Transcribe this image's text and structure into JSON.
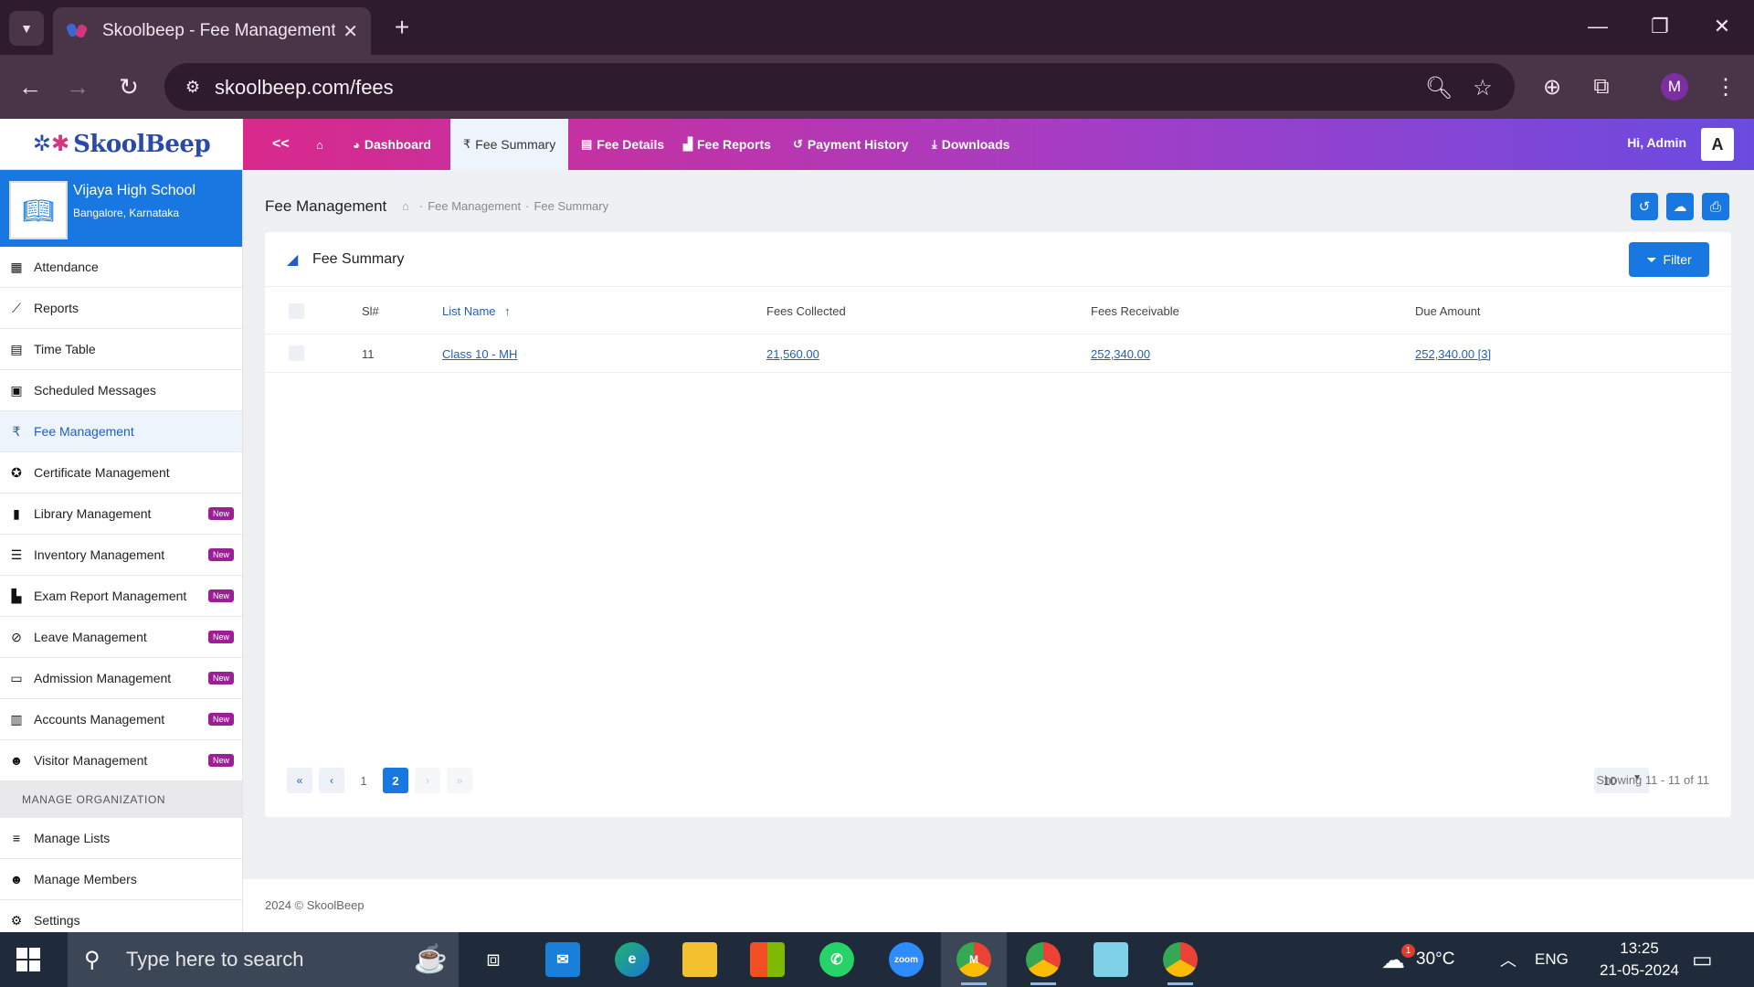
{
  "browser": {
    "tab_title": "Skoolbeep - Fee Management",
    "close_glyph": "✕",
    "new_tab_glyph": "+",
    "url": "skoolbeep.com/fees",
    "profile_initial": "M"
  },
  "app": {
    "logo_text": "SkoolBeep",
    "nav": [
      {
        "label": "<<"
      },
      {
        "label": "Dashboard"
      },
      {
        "label": "Fee Summary"
      },
      {
        "label": "Fee Details"
      },
      {
        "label": "Fee Reports"
      },
      {
        "label": "Payment History"
      },
      {
        "label": "Downloads"
      }
    ],
    "greeting": "Hi, Admin",
    "avatar_initial": "A"
  },
  "sidebar": {
    "school_name": "Vijaya High School",
    "school_location": "Bangalore, Karnataka",
    "new_badge": "New",
    "items": [
      {
        "label": "Attendance",
        "icon": "calendar-icon"
      },
      {
        "label": "Reports",
        "icon": "chart-line-icon"
      },
      {
        "label": "Time Table",
        "icon": "timetable-icon"
      },
      {
        "label": "Scheduled Messages",
        "icon": "calendar-check-icon"
      },
      {
        "label": "Fee Management",
        "icon": "rupee-icon"
      },
      {
        "label": "Certificate Management",
        "icon": "award-icon"
      },
      {
        "label": "Library Management",
        "icon": "book-icon"
      },
      {
        "label": "Inventory Management",
        "icon": "list-icon"
      },
      {
        "label": "Exam Report Management",
        "icon": "file-icon"
      },
      {
        "label": "Leave Management",
        "icon": "user-slash-icon"
      },
      {
        "label": "Admission Management",
        "icon": "id-card-icon"
      },
      {
        "label": "Accounts Management",
        "icon": "file-invoice-icon"
      },
      {
        "label": "Visitor Management",
        "icon": "users-icon"
      }
    ],
    "section_label": "MANAGE ORGANIZATION",
    "org_items": [
      {
        "label": "Manage Lists",
        "icon": "list-ul-icon"
      },
      {
        "label": "Manage Members",
        "icon": "users-icon"
      },
      {
        "label": "Settings",
        "icon": "gear-icon"
      }
    ]
  },
  "main": {
    "page_title": "Fee Management",
    "breadcrumb": [
      "Fee Management",
      "Fee Summary"
    ],
    "card_title": "Fee Summary",
    "filter_label": "Filter",
    "table": {
      "columns": [
        "Sl#",
        "List Name",
        "Fees Collected",
        "Fees Receivable",
        "Due Amount"
      ],
      "rows": [
        {
          "sl": "11",
          "list_name": "Class 10 - MH",
          "fees_collected": "21,560.00",
          "fees_receivable": "252,340.00",
          "due_amount": "252,340.00 [3]"
        }
      ]
    },
    "pagination": {
      "pages": [
        "1",
        "2"
      ],
      "current_page": "2",
      "per_page": "10",
      "showing": "Showing 11 - 11 of 11"
    },
    "footer": "2024 © SkoolBeep"
  },
  "taskbar": {
    "search_placeholder": "Type here to search",
    "weather_temp": "30°C",
    "weather_badge": "1",
    "language": "ENG",
    "time": "13:25",
    "date": "21-05-2024",
    "zoom_label": "zoom",
    "chrome_profile_badge": "M"
  },
  "colors": {
    "accent": "#1877e0",
    "nav_gradient_start": "#d9298c",
    "nav_gradient_end": "#6a4be0",
    "new_badge": "#9b1f95",
    "browser_frame": "#2e1b2e"
  }
}
